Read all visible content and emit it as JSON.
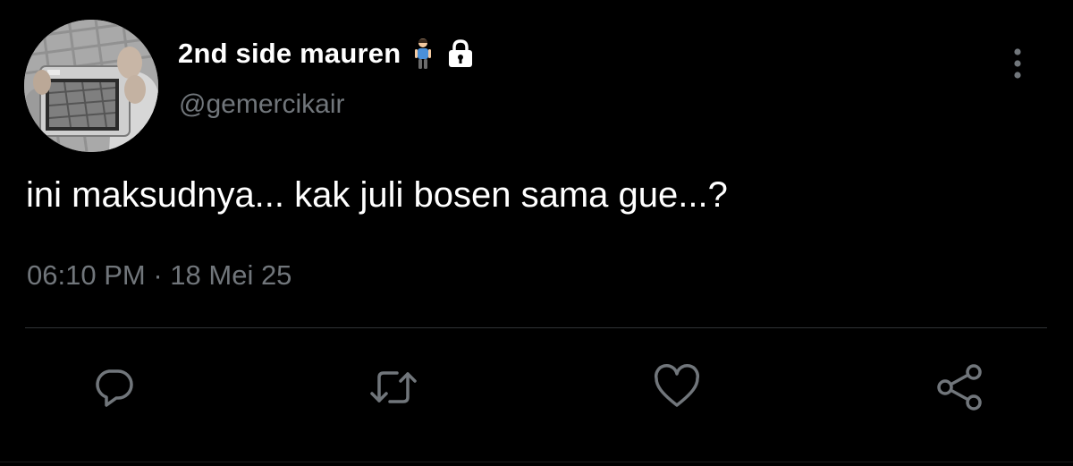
{
  "user": {
    "display_name": "2nd side mauren",
    "name_emoji": "person-standing-emoji",
    "protected_badge": "lock-icon",
    "handle": "@gemercikair",
    "avatar": "avatar-photo-hand-holding-camera"
  },
  "tweet": {
    "text": "ini maksudnya... kak juli bosen sama gue...?",
    "time": "06:10 PM",
    "separator": "·",
    "date": "18 Mei 25"
  },
  "actions": [
    {
      "name": "reply",
      "icon": "reply-bubble-icon"
    },
    {
      "name": "retweet",
      "icon": "retweet-icon"
    },
    {
      "name": "like",
      "icon": "heart-icon"
    },
    {
      "name": "share",
      "icon": "share-icon"
    }
  ],
  "menu": {
    "icon": "more-vertical-icon"
  },
  "colors": {
    "background": "#000000",
    "text_primary": "#ffffff",
    "text_secondary": "#71767b",
    "divider": "#2f3336",
    "icon": "#71767b"
  }
}
